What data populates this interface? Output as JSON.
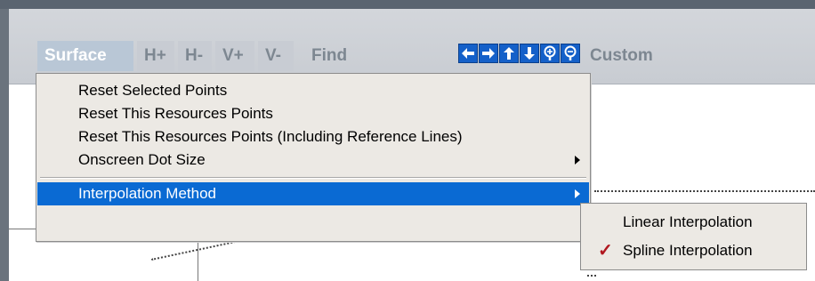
{
  "toolbar": {
    "surface": "Surface",
    "h_plus": "H+",
    "h_minus": "H-",
    "v_plus": "V+",
    "v_minus": "V-",
    "find": "Find",
    "custom": "Custom",
    "icons": [
      "arrow-left-icon",
      "arrow-right-icon",
      "arrow-up-icon",
      "arrow-down-icon",
      "zoom-in-icon",
      "zoom-out-icon"
    ]
  },
  "menu": {
    "items": [
      {
        "label": "Reset Selected Points"
      },
      {
        "label": "Reset This Resources Points"
      },
      {
        "label": "Reset This Resources Points (Including Reference Lines)"
      },
      {
        "label": "Onscreen Dot Size"
      },
      {
        "label": "Interpolation Method"
      }
    ]
  },
  "submenu": {
    "items": [
      {
        "label": "Linear Interpolation",
        "checked": false
      },
      {
        "label": "Spline Interpolation",
        "checked": true
      }
    ],
    "check_glyph": "✓"
  },
  "colors": {
    "highlight": "#0a6ad3",
    "menu_bg": "#ece9e4",
    "toolbar_bg": "#c8ccd2",
    "icon_blue": "#1460c9",
    "check_red": "#b0171f"
  }
}
